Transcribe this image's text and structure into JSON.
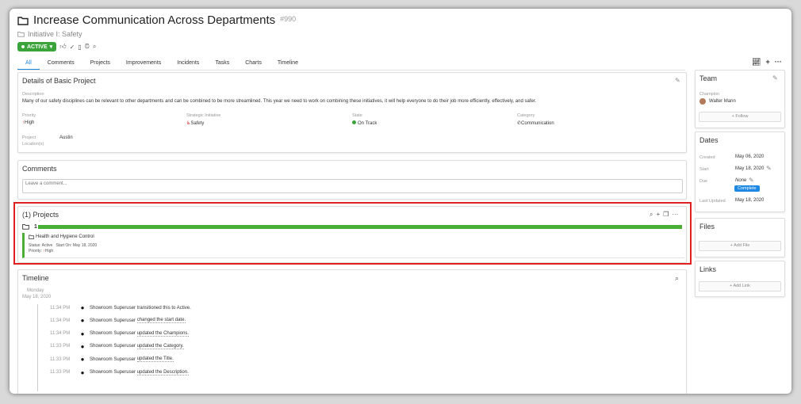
{
  "header": {
    "title": "Increase Communication Across Departments",
    "id": "#990",
    "subtitle": "Initiative I: Safety",
    "status": "ACTIVE"
  },
  "tabs": [
    "All",
    "Comments",
    "Projects",
    "Improvements",
    "Incidents",
    "Tasks",
    "Charts",
    "Timeline"
  ],
  "details": {
    "title": "Details of Basic Project",
    "description_label": "Description",
    "description": "Many of our safety disciplines can be relevant to other departments and can be combined to be more streamlined. This year we need to work on combining these initiatives, it will help everyone to do their job more efficiently, effectively, and safer.",
    "priority_label": "Priority",
    "priority": "High",
    "strategic_label": "Strategic Initiative",
    "strategic": "Safety",
    "state_label": "State",
    "state": "On Track",
    "category_label": "Category",
    "category": "Communication",
    "location_label": "Project Location(s)",
    "location": "Austin"
  },
  "comments": {
    "title": "Comments",
    "placeholder": "Leave a comment..."
  },
  "projects": {
    "title": "(1) Projects",
    "count": "1",
    "progress": 1.0,
    "item_name": "Health and Hygiene Control",
    "item_status": "Status: Active",
    "item_start": "Start On: May 18, 2020",
    "item_priority_label": "Priority:",
    "item_priority": "High"
  },
  "timeline": {
    "title": "Timeline",
    "day": "Monday",
    "date": "May 18, 2020",
    "events": [
      {
        "time": "11:34 PM",
        "user": "Showroom Superuser",
        "pre": "transitioned this to Active.",
        "link": ""
      },
      {
        "time": "11:34 PM",
        "user": "Showroom Superuser",
        "pre": "",
        "link": "changed the start date."
      },
      {
        "time": "11:34 PM",
        "user": "Showroom Superuser",
        "pre": "",
        "link": "updated the Champions."
      },
      {
        "time": "11:33 PM",
        "user": "Showroom Superuser",
        "pre": "",
        "link": "updated the Category."
      },
      {
        "time": "11:33 PM",
        "user": "Showroom Superuser",
        "pre": "",
        "link": "updated the Title."
      },
      {
        "time": "11:33 PM",
        "user": "Showroom Superuser",
        "pre": "",
        "link": "updated the Description."
      }
    ]
  },
  "team": {
    "title": "Team",
    "champion_label": "Champion",
    "champion": "Walter Mann",
    "follow": "Follow"
  },
  "dates": {
    "title": "Dates",
    "created_label": "Created",
    "created": "May 06, 2020",
    "start_label": "Start",
    "start": "May 18, 2020",
    "due_label": "Due",
    "due": "None",
    "complete": "Complete",
    "updated_label": "Last Updated",
    "updated": "May 18, 2020"
  },
  "files": {
    "title": "Files",
    "add": "Add File"
  },
  "links": {
    "title": "Links",
    "add": "Add Link"
  },
  "colors": {
    "accent": "#1e88e5",
    "success": "#3aa43a",
    "danger": "#e02020"
  }
}
